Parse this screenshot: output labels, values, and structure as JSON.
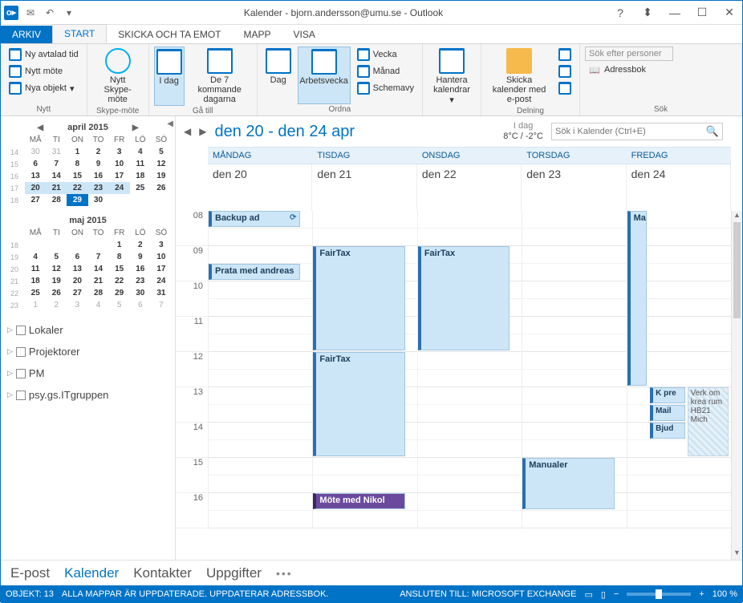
{
  "title": "Kalender - bjorn.andersson@umu.se - Outlook",
  "tabs": {
    "file": "ARKIV",
    "start": "START",
    "send": "SKICKA OCH TA EMOT",
    "folder": "MAPP",
    "view": "VISA"
  },
  "ribbon": {
    "new_group": "Nytt",
    "new_appt": "Ny avtalad tid",
    "new_meeting": "Nytt möte",
    "new_items": "Nya objekt",
    "skype_group": "Skype-möte",
    "skype_btn": "Nytt Skype-möte",
    "goto_group": "Gå till",
    "today": "I dag",
    "next7": "De 7 kommande dagarna",
    "arrange_group": "Ordna",
    "day": "Dag",
    "workweek": "Arbetsvecka",
    "week": "Vecka",
    "month": "Månad",
    "schedule": "Schemavy",
    "manage_group": "Hantera kalendrar",
    "share_group": "Delning",
    "share_email": "Skicka kalender med e-post",
    "search_group": "Sök",
    "search_people": "Sök efter personer",
    "addressbook": "Adressbok"
  },
  "minical1": {
    "title": "april 2015",
    "dow": [
      "MÅ",
      "TI",
      "ON",
      "TO",
      "FR",
      "LÖ",
      "SÖ"
    ],
    "rows": [
      {
        "wk": "14",
        "d": [
          "30",
          "31",
          "1",
          "2",
          "3",
          "4",
          "5"
        ],
        "dim": [
          0,
          1
        ]
      },
      {
        "wk": "15",
        "d": [
          "6",
          "7",
          "8",
          "9",
          "10",
          "11",
          "12"
        ]
      },
      {
        "wk": "16",
        "d": [
          "13",
          "14",
          "15",
          "16",
          "17",
          "18",
          "19"
        ]
      },
      {
        "wk": "17",
        "d": [
          "20",
          "21",
          "22",
          "23",
          "24",
          "25",
          "26"
        ],
        "hl": [
          0,
          1,
          2,
          3,
          4
        ]
      },
      {
        "wk": "18",
        "d": [
          "27",
          "28",
          "29",
          "30",
          "",
          "",
          ""
        ],
        "today": 2
      }
    ]
  },
  "minical2": {
    "title": "maj 2015",
    "dow": [
      "MÅ",
      "TI",
      "ON",
      "TO",
      "FR",
      "LÖ",
      "SÖ"
    ],
    "rows": [
      {
        "wk": "18",
        "d": [
          "",
          "",
          "",
          "",
          "1",
          "2",
          "3"
        ]
      },
      {
        "wk": "19",
        "d": [
          "4",
          "5",
          "6",
          "7",
          "8",
          "9",
          "10"
        ]
      },
      {
        "wk": "20",
        "d": [
          "11",
          "12",
          "13",
          "14",
          "15",
          "16",
          "17"
        ]
      },
      {
        "wk": "21",
        "d": [
          "18",
          "19",
          "20",
          "21",
          "22",
          "23",
          "24"
        ]
      },
      {
        "wk": "22",
        "d": [
          "25",
          "26",
          "27",
          "28",
          "29",
          "30",
          "31"
        ]
      },
      {
        "wk": "23",
        "d": [
          "1",
          "2",
          "3",
          "4",
          "5",
          "6",
          "7"
        ],
        "dim": [
          0,
          1,
          2,
          3,
          4,
          5,
          6
        ]
      }
    ]
  },
  "side_groups": [
    "Lokaler",
    "Projektorer",
    "PM",
    "psy.gs.ITgruppen"
  ],
  "cal": {
    "range": "den 20 - den 24 apr",
    "today_lbl": "I dag",
    "temp": "8°C / -2°C",
    "search_ph": "Sök i Kalender (Ctrl+E)",
    "days": [
      "MÅNDAG",
      "TISDAG",
      "ONSDAG",
      "TORSDAG",
      "FREDAG"
    ],
    "dates": [
      "den 20",
      "den 21",
      "den 22",
      "den 23",
      "den 24"
    ],
    "hours": [
      "08",
      "09",
      "10",
      "11",
      "12",
      "13",
      "14",
      "15",
      "16"
    ]
  },
  "appts": {
    "backup": "Backup ad",
    "prata": "Prata med andreas",
    "fairtax": "FairTax",
    "fairtax2": "FairTax",
    "fairtax3": "FairTax",
    "mote_nikol": "Möte med Nikol",
    "manualer": "Manualer",
    "man": "Man",
    "kpre": "K pre",
    "mail": "Mail",
    "bjud": "Bjud",
    "verk": "Verk om krea rum HB21 Mich"
  },
  "bottom": {
    "mail": "E-post",
    "cal": "Kalender",
    "contacts": "Kontakter",
    "tasks": "Uppgifter"
  },
  "status": {
    "objects": "OBJEKT: 13",
    "folders": "ALLA MAPPAR ÄR UPPDATERADE.  UPPDATERAR ADRESSBOK.",
    "conn": "ANSLUTEN TILL: MICROSOFT EXCHANGE",
    "zoom": "100 %"
  }
}
